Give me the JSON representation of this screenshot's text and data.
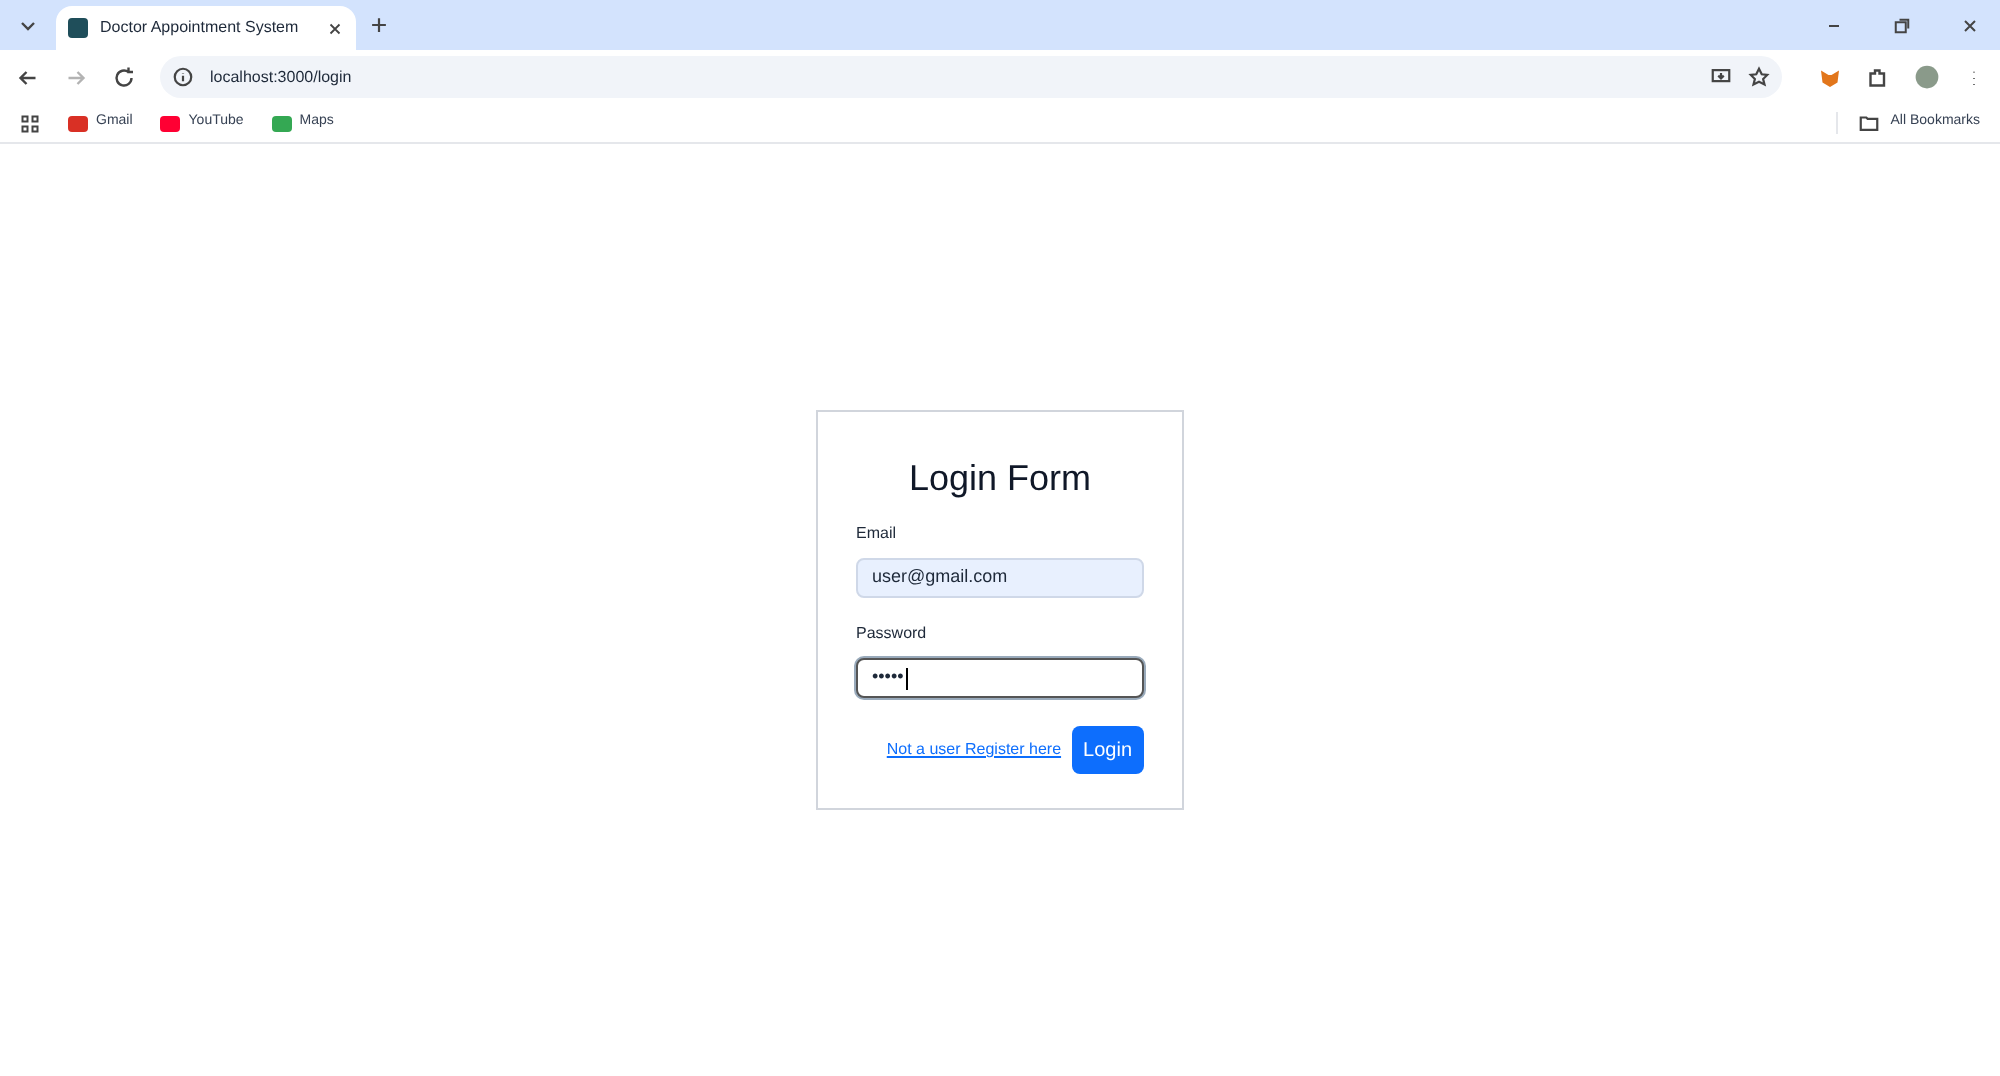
{
  "browser": {
    "tabs": [
      {
        "title": "Doctor Appointment System",
        "selected": true
      }
    ],
    "url": "localhost:3000/login",
    "bookmarks": [
      {
        "label": "Gmail",
        "color": "#d93025"
      },
      {
        "label": "YouTube",
        "color": "#ff0033"
      },
      {
        "label": "Maps",
        "color": "#34a853"
      }
    ],
    "all_bookmarks": "All Bookmarks"
  },
  "form": {
    "title": "Login Form",
    "fields": [
      {
        "label": "Email",
        "value": "user@gmail.com",
        "focused": false,
        "autofilled": true
      },
      {
        "label": "Password",
        "value": "•••••",
        "focused": true,
        "autofilled": false
      }
    ],
    "register_link": "Not a user Register here",
    "submit": "Login"
  }
}
